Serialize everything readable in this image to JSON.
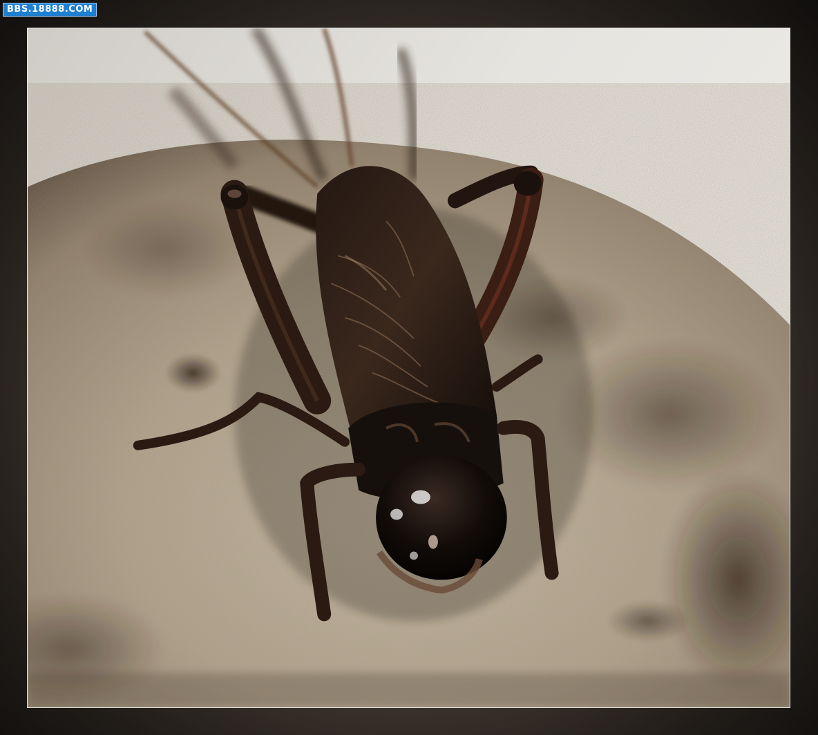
{
  "watermark": {
    "text": "BBS.18888.COM"
  },
  "photo": {
    "subject_icon": "cricket-insect-icon",
    "colors": {
      "wall": "#e4e2dd",
      "ground": "#b7ab98",
      "ground_dark": "#3a2b1f",
      "insect_body": "#1c1410",
      "insect_highlight": "#6a4a34",
      "legs": "#2a1a12"
    }
  }
}
